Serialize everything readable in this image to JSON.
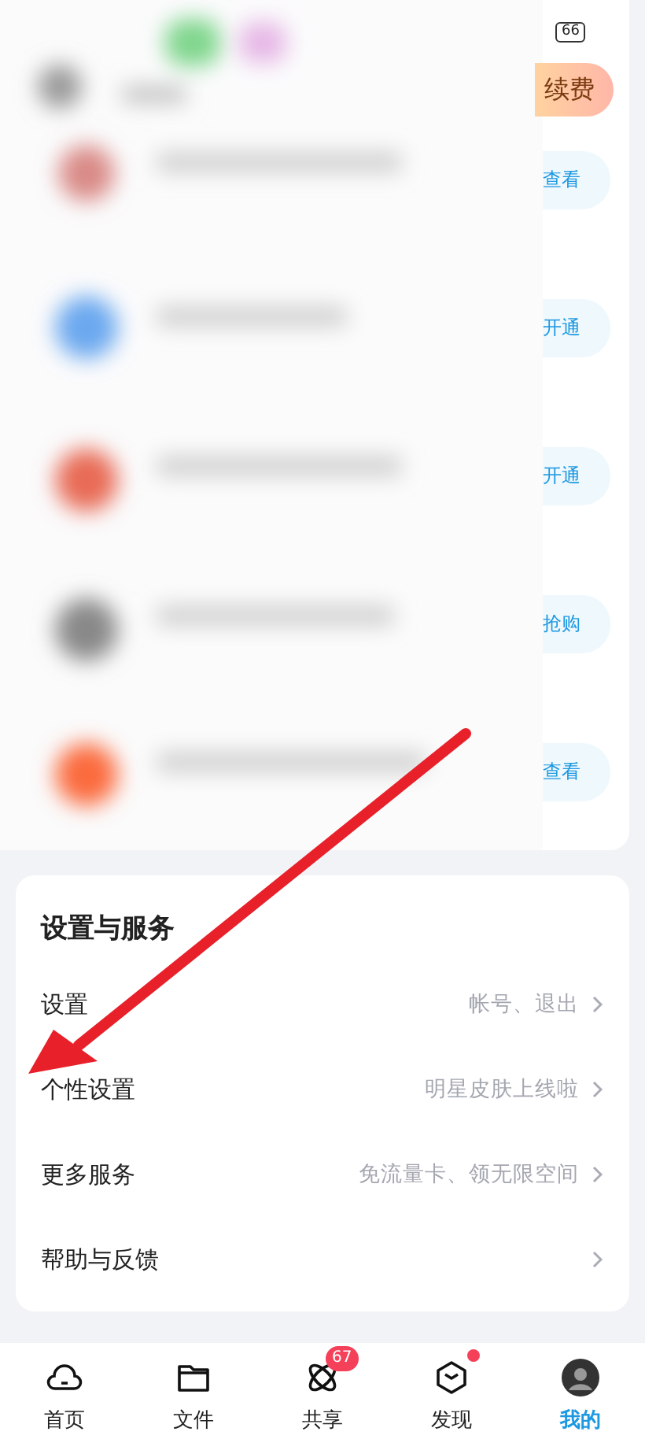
{
  "status_bar": {
    "battery": "66"
  },
  "renew_button": {
    "label": "续费"
  },
  "promo_rows": [
    {
      "action": "查看"
    },
    {
      "action": "开通"
    },
    {
      "action": "开通"
    },
    {
      "action": "抢购"
    },
    {
      "action": "查看"
    }
  ],
  "settings": {
    "title": "设置与服务",
    "items": [
      {
        "label": "设置",
        "hint": "帐号、退出"
      },
      {
        "label": "个性设置",
        "hint": "明星皮肤上线啦"
      },
      {
        "label": "更多服务",
        "hint": "免流量卡、领无限空间"
      },
      {
        "label": "帮助与反馈"
      }
    ]
  },
  "tab_bar": {
    "tabs": [
      {
        "label": "首页",
        "kind": "cloud",
        "selected": false,
        "dot": false
      },
      {
        "label": "文件",
        "kind": "folder",
        "selected": false,
        "dot": false
      },
      {
        "label": "共享",
        "kind": "atom",
        "selected": false,
        "dot": false,
        "badge": "67"
      },
      {
        "label": "发现",
        "kind": "cube",
        "selected": false,
        "dot": true
      },
      {
        "label": "我的",
        "kind": "avatar",
        "selected": true,
        "dot": false
      }
    ]
  }
}
